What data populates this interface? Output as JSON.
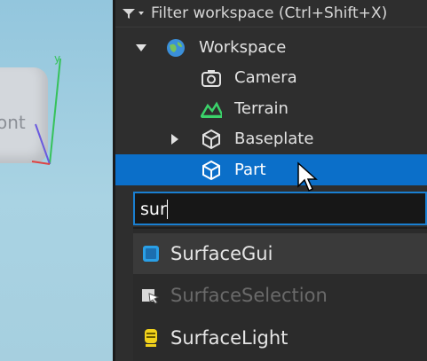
{
  "viewport": {
    "front_label": "ont",
    "axis_label": "y"
  },
  "explorer": {
    "filter_placeholder": "Filter workspace (Ctrl+Shift+X)",
    "tree": [
      {
        "label": "Workspace",
        "icon": "workspace-globe-icon"
      },
      {
        "label": "Camera",
        "icon": "camera-icon"
      },
      {
        "label": "Terrain",
        "icon": "terrain-icon"
      },
      {
        "label": "Baseplate",
        "icon": "part-cube-icon"
      },
      {
        "label": "Part",
        "icon": "part-cube-icon"
      }
    ]
  },
  "insert_search": {
    "value": "sur",
    "results": [
      {
        "label": "SurfaceGui",
        "icon": "surface-gui-icon",
        "enabled": true
      },
      {
        "label": "SurfaceSelection",
        "icon": "surface-selection-icon",
        "enabled": false
      },
      {
        "label": "SurfaceLight",
        "icon": "surface-light-icon",
        "enabled": true
      }
    ]
  },
  "colors": {
    "selection": "#0b6fc9",
    "search_border": "#1a7fd1"
  }
}
